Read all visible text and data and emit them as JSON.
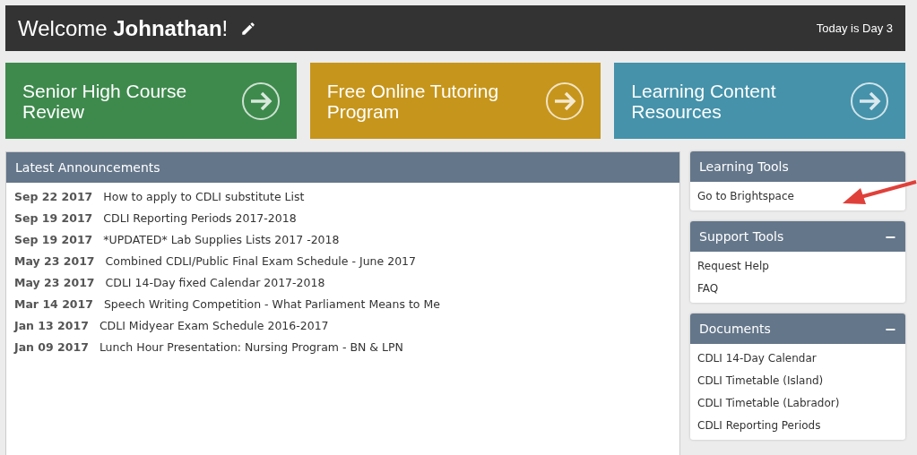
{
  "header": {
    "welcome": "Welcome **Johnathan**!",
    "day": "Today is Day 3"
  },
  "tiles": [
    {
      "label": "Senior High Course Review",
      "color": "#3e8a4d"
    },
    {
      "label": "Free Online Tutoring Program",
      "color": "#c6951b"
    },
    {
      "label": "Learning Content Resources",
      "color": "#4592aa"
    }
  ],
  "announcements": {
    "title": "Latest Announcements",
    "items": [
      {
        "date": "Sep 22 2017",
        "text": "How to apply to CDLI substitute List"
      },
      {
        "date": "Sep 19 2017",
        "text": "CDLI Reporting Periods 2017-2018"
      },
      {
        "date": "Sep 19 2017",
        "text": "*UPDATED* Lab Supplies Lists 2017 -2018"
      },
      {
        "date": "May 23 2017",
        "text": "Combined CDLI/Public Final Exam Schedule - June 2017"
      },
      {
        "date": "May 23 2017",
        "text": "CDLI 14-Day fixed Calendar 2017-2018"
      },
      {
        "date": "Mar 14 2017",
        "text": "Speech Writing Competition - What Parliament Means to Me"
      },
      {
        "date": "Jan 13 2017",
        "text": "CDLI Midyear Exam Schedule 2016-2017"
      },
      {
        "date": "Jan 09 2017",
        "text": "Lunch Hour Presentation: Nursing Program - BN & LPN"
      }
    ]
  },
  "sidebar": [
    {
      "title": "Learning Tools",
      "links": [
        "Go to Brightspace"
      ]
    },
    {
      "title": "Support Tools",
      "toggle": "−",
      "links": [
        "Request Help",
        "FAQ"
      ]
    },
    {
      "title": "Documents",
      "toggle": "−",
      "links": [
        "CDLI 14-Day Calendar",
        "CDLI Timetable (Island)",
        "CDLI Timetable (Labrador)",
        "CDLI Reporting Periods"
      ]
    }
  ]
}
